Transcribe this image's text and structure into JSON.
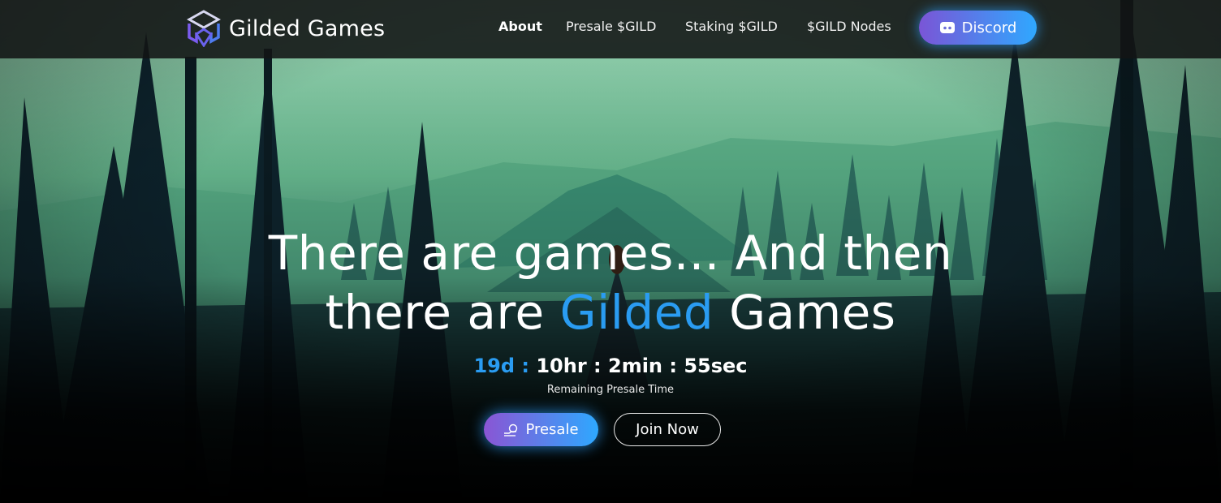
{
  "brand": {
    "name": "Gilded Games",
    "logo_icon": "cube-logo-icon"
  },
  "nav": {
    "links": [
      {
        "label": "About",
        "active": true
      },
      {
        "label": "Presale $GILD",
        "active": false
      },
      {
        "label": "Staking $GILD",
        "active": false
      },
      {
        "label": "$GILD Nodes",
        "active": false
      }
    ],
    "discord": {
      "label": "Discord",
      "icon": "discord-icon"
    }
  },
  "hero": {
    "headline_line1": "There are games... And then",
    "headline_line2_pre": "there are ",
    "headline_line2_accent": "Gilded",
    "headline_line2_post": " Games",
    "countdown": {
      "days": "19d :",
      "rest": "10hr : 2min : 55sec"
    },
    "countdown_caption": "Remaining Presale Time",
    "buttons": {
      "presale": {
        "label": "Presale",
        "icon": "coin-hand-icon"
      },
      "join": {
        "label": "Join Now"
      }
    }
  },
  "colors": {
    "accent": "#2a9cf2",
    "gradient_start": "#7a55d6",
    "gradient_end": "#2fa8ff",
    "nav_bg": "#121414"
  }
}
